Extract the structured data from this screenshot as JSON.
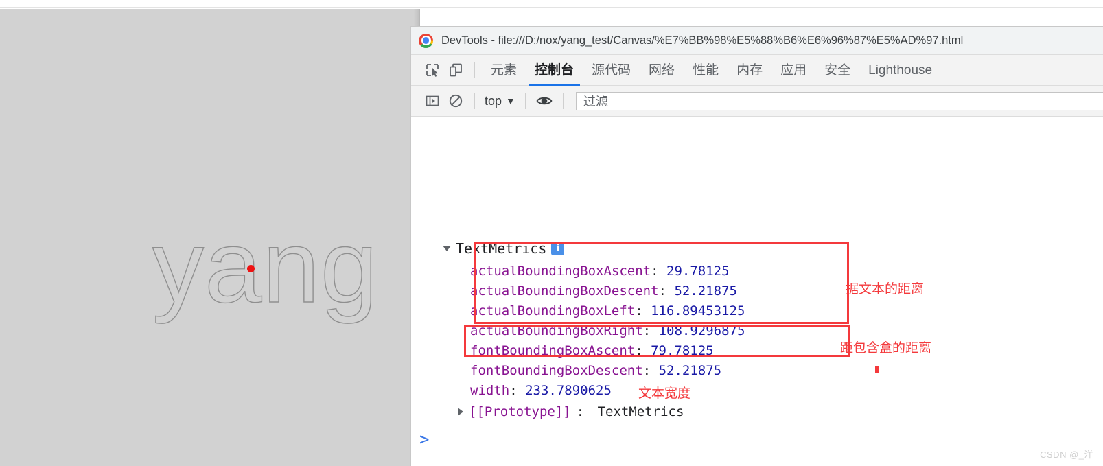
{
  "page": {
    "canvas_text": "yang",
    "canvas_bg_color": "#d2d2d2",
    "canvas_stroke_color": "#8f8f8f",
    "dot_color": "#ee1111"
  },
  "window": {
    "title": "DevTools - file:///D:/nox/yang_test/Canvas/%E7%BB%98%E5%88%B6%E6%96%87%E5%AD%97.html",
    "logo": "chrome-logo"
  },
  "tabbar": {
    "inspect_icon": "inspect-element-icon",
    "device_icon": "device-toolbar-icon",
    "tabs": [
      {
        "label": "元素",
        "active": false
      },
      {
        "label": "控制台",
        "active": true
      },
      {
        "label": "源代码",
        "active": false
      },
      {
        "label": "网络",
        "active": false
      },
      {
        "label": "性能",
        "active": false
      },
      {
        "label": "内存",
        "active": false
      },
      {
        "label": "应用",
        "active": false
      },
      {
        "label": "安全",
        "active": false
      },
      {
        "label": "Lighthouse",
        "active": false
      }
    ],
    "active_underline_color": "#1a73e8"
  },
  "console_toolbar": {
    "sidebar_icon": "console-sidebar-icon",
    "clear_icon": "clear-console-icon",
    "context": "top",
    "context_caret": "▼",
    "eye_icon": "live-expression-eye-icon",
    "filter_placeholder": "过滤"
  },
  "console": {
    "object_name": "TextMetrics",
    "expand_icon": "triangle-down-icon",
    "info_icon": "info-icon",
    "info_letter": "i",
    "properties": [
      {
        "key": "actualBoundingBoxAscent",
        "value": "29.78125"
      },
      {
        "key": "actualBoundingBoxDescent",
        "value": "52.21875"
      },
      {
        "key": "actualBoundingBoxLeft",
        "value": "116.89453125"
      },
      {
        "key": "actualBoundingBoxRight",
        "value": "108.9296875"
      },
      {
        "key": "fontBoundingBoxAscent",
        "value": "79.78125"
      },
      {
        "key": "fontBoundingBoxDescent",
        "value": "52.21875"
      },
      {
        "key": "width",
        "value": "233.7890625"
      }
    ],
    "prototype_key": "[[Prototype]]",
    "prototype_value": "TextMetrics",
    "prototype_icon": "triangle-right-icon",
    "prompt_symbol": ">",
    "annotations": [
      {
        "text": "据文本的距离"
      },
      {
        "text": "距包含盒的距离"
      },
      {
        "text": "文本宽度"
      }
    ],
    "annotation_color": "#f4393c"
  },
  "watermark": "CSDN @_洋"
}
